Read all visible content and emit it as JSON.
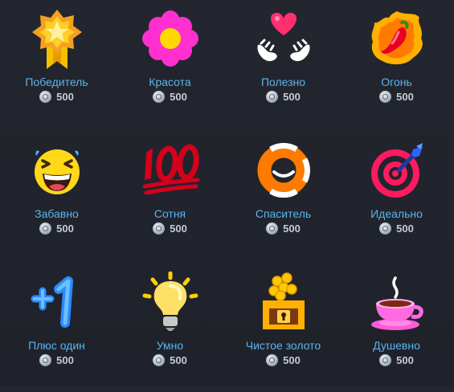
{
  "awards": [
    {
      "label": "Победитель",
      "price": "500",
      "icon": "medal-icon"
    },
    {
      "label": "Красота",
      "price": "500",
      "icon": "flower-icon"
    },
    {
      "label": "Полезно",
      "price": "500",
      "icon": "hands-heart-icon"
    },
    {
      "label": "Огонь",
      "price": "500",
      "icon": "fire-pepper-icon"
    },
    {
      "label": "Забавно",
      "price": "500",
      "icon": "laughing-face-icon"
    },
    {
      "label": "Сотня",
      "price": "500",
      "icon": "hundred-points-icon"
    },
    {
      "label": "Спаситель",
      "price": "500",
      "icon": "lifebuoy-icon"
    },
    {
      "label": "Идеально",
      "price": "500",
      "icon": "bullseye-icon"
    },
    {
      "label": "Плюс один",
      "price": "500",
      "icon": "plus-one-icon"
    },
    {
      "label": "Умно",
      "price": "500",
      "icon": "lightbulb-icon"
    },
    {
      "label": "Чистое золото",
      "price": "500",
      "icon": "treasure-chest-icon"
    },
    {
      "label": "Душевно",
      "price": "500",
      "icon": "tea-cup-icon"
    }
  ],
  "colors": {
    "label": "#5ab4f0",
    "price": "#c6ccd6",
    "background": "#22252d"
  }
}
